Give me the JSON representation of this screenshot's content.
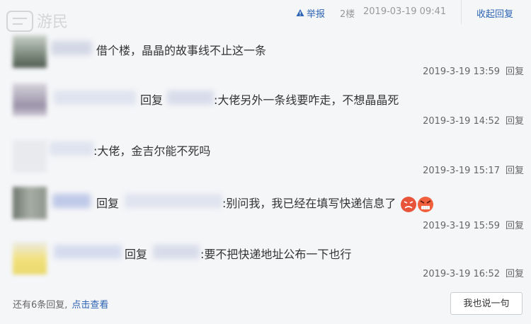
{
  "header": {
    "report_label": "举报",
    "floor_label": "2楼",
    "post_time": "2019-03-19 09:41",
    "collapse_label": "收起回复"
  },
  "watermark_text": "游民",
  "replies": [
    {
      "prefix": "",
      "target": "",
      "text": "借个楼，晶晶的故事线不止这一条",
      "time": "2019-3-19 13:59",
      "reply_label": "回复"
    },
    {
      "prefix": "回复",
      "target": "",
      "text": ":大佬另外一条线要咋走，不想晶晶死",
      "time": "2019-3-19 14:52",
      "reply_label": "回复"
    },
    {
      "prefix": "",
      "target": "",
      "text": ":大佬，金吉尔能不死吗",
      "time": "2019-3-19 15:17",
      "reply_label": "回复"
    },
    {
      "prefix": "回复",
      "target": "",
      "text": ":别问我，我已经在填写快递信息了",
      "time": "2019-3-19 15:59",
      "reply_label": "回复"
    },
    {
      "prefix": "回复",
      "target": "",
      "text": ":要不把快递地址公布一下也行",
      "time": "2019-3-19 16:52",
      "reply_label": "回复"
    }
  ],
  "footer": {
    "more_replies": "还有6条回复,",
    "view_label": "点击查看",
    "say_button": "我也说一句"
  },
  "colors": {
    "link": "#2d64b3",
    "background": "#f5f6f8"
  }
}
